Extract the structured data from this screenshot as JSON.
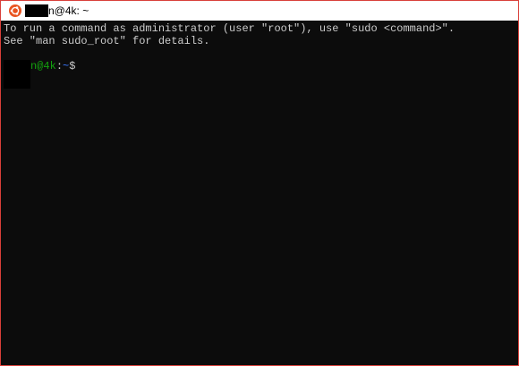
{
  "window": {
    "title": "n@4k: ~"
  },
  "icons": {
    "app": "ubuntu-logo-icon"
  },
  "terminal": {
    "lines": [
      "To run a command as administrator (user \"root\"), use \"sudo <command>\".",
      "See \"man sudo_root\" for details."
    ],
    "prompt": {
      "user_host": "n@4k",
      "colon": ":",
      "path": "~",
      "symbol": "$"
    }
  },
  "colors": {
    "accent_border": "#d9403a",
    "ubuntu_orange": "#e95420",
    "terminal_bg": "#0c0c0c",
    "text": "#cccccc",
    "prompt_green": "#13a10e",
    "prompt_blue": "#3b78ff"
  }
}
